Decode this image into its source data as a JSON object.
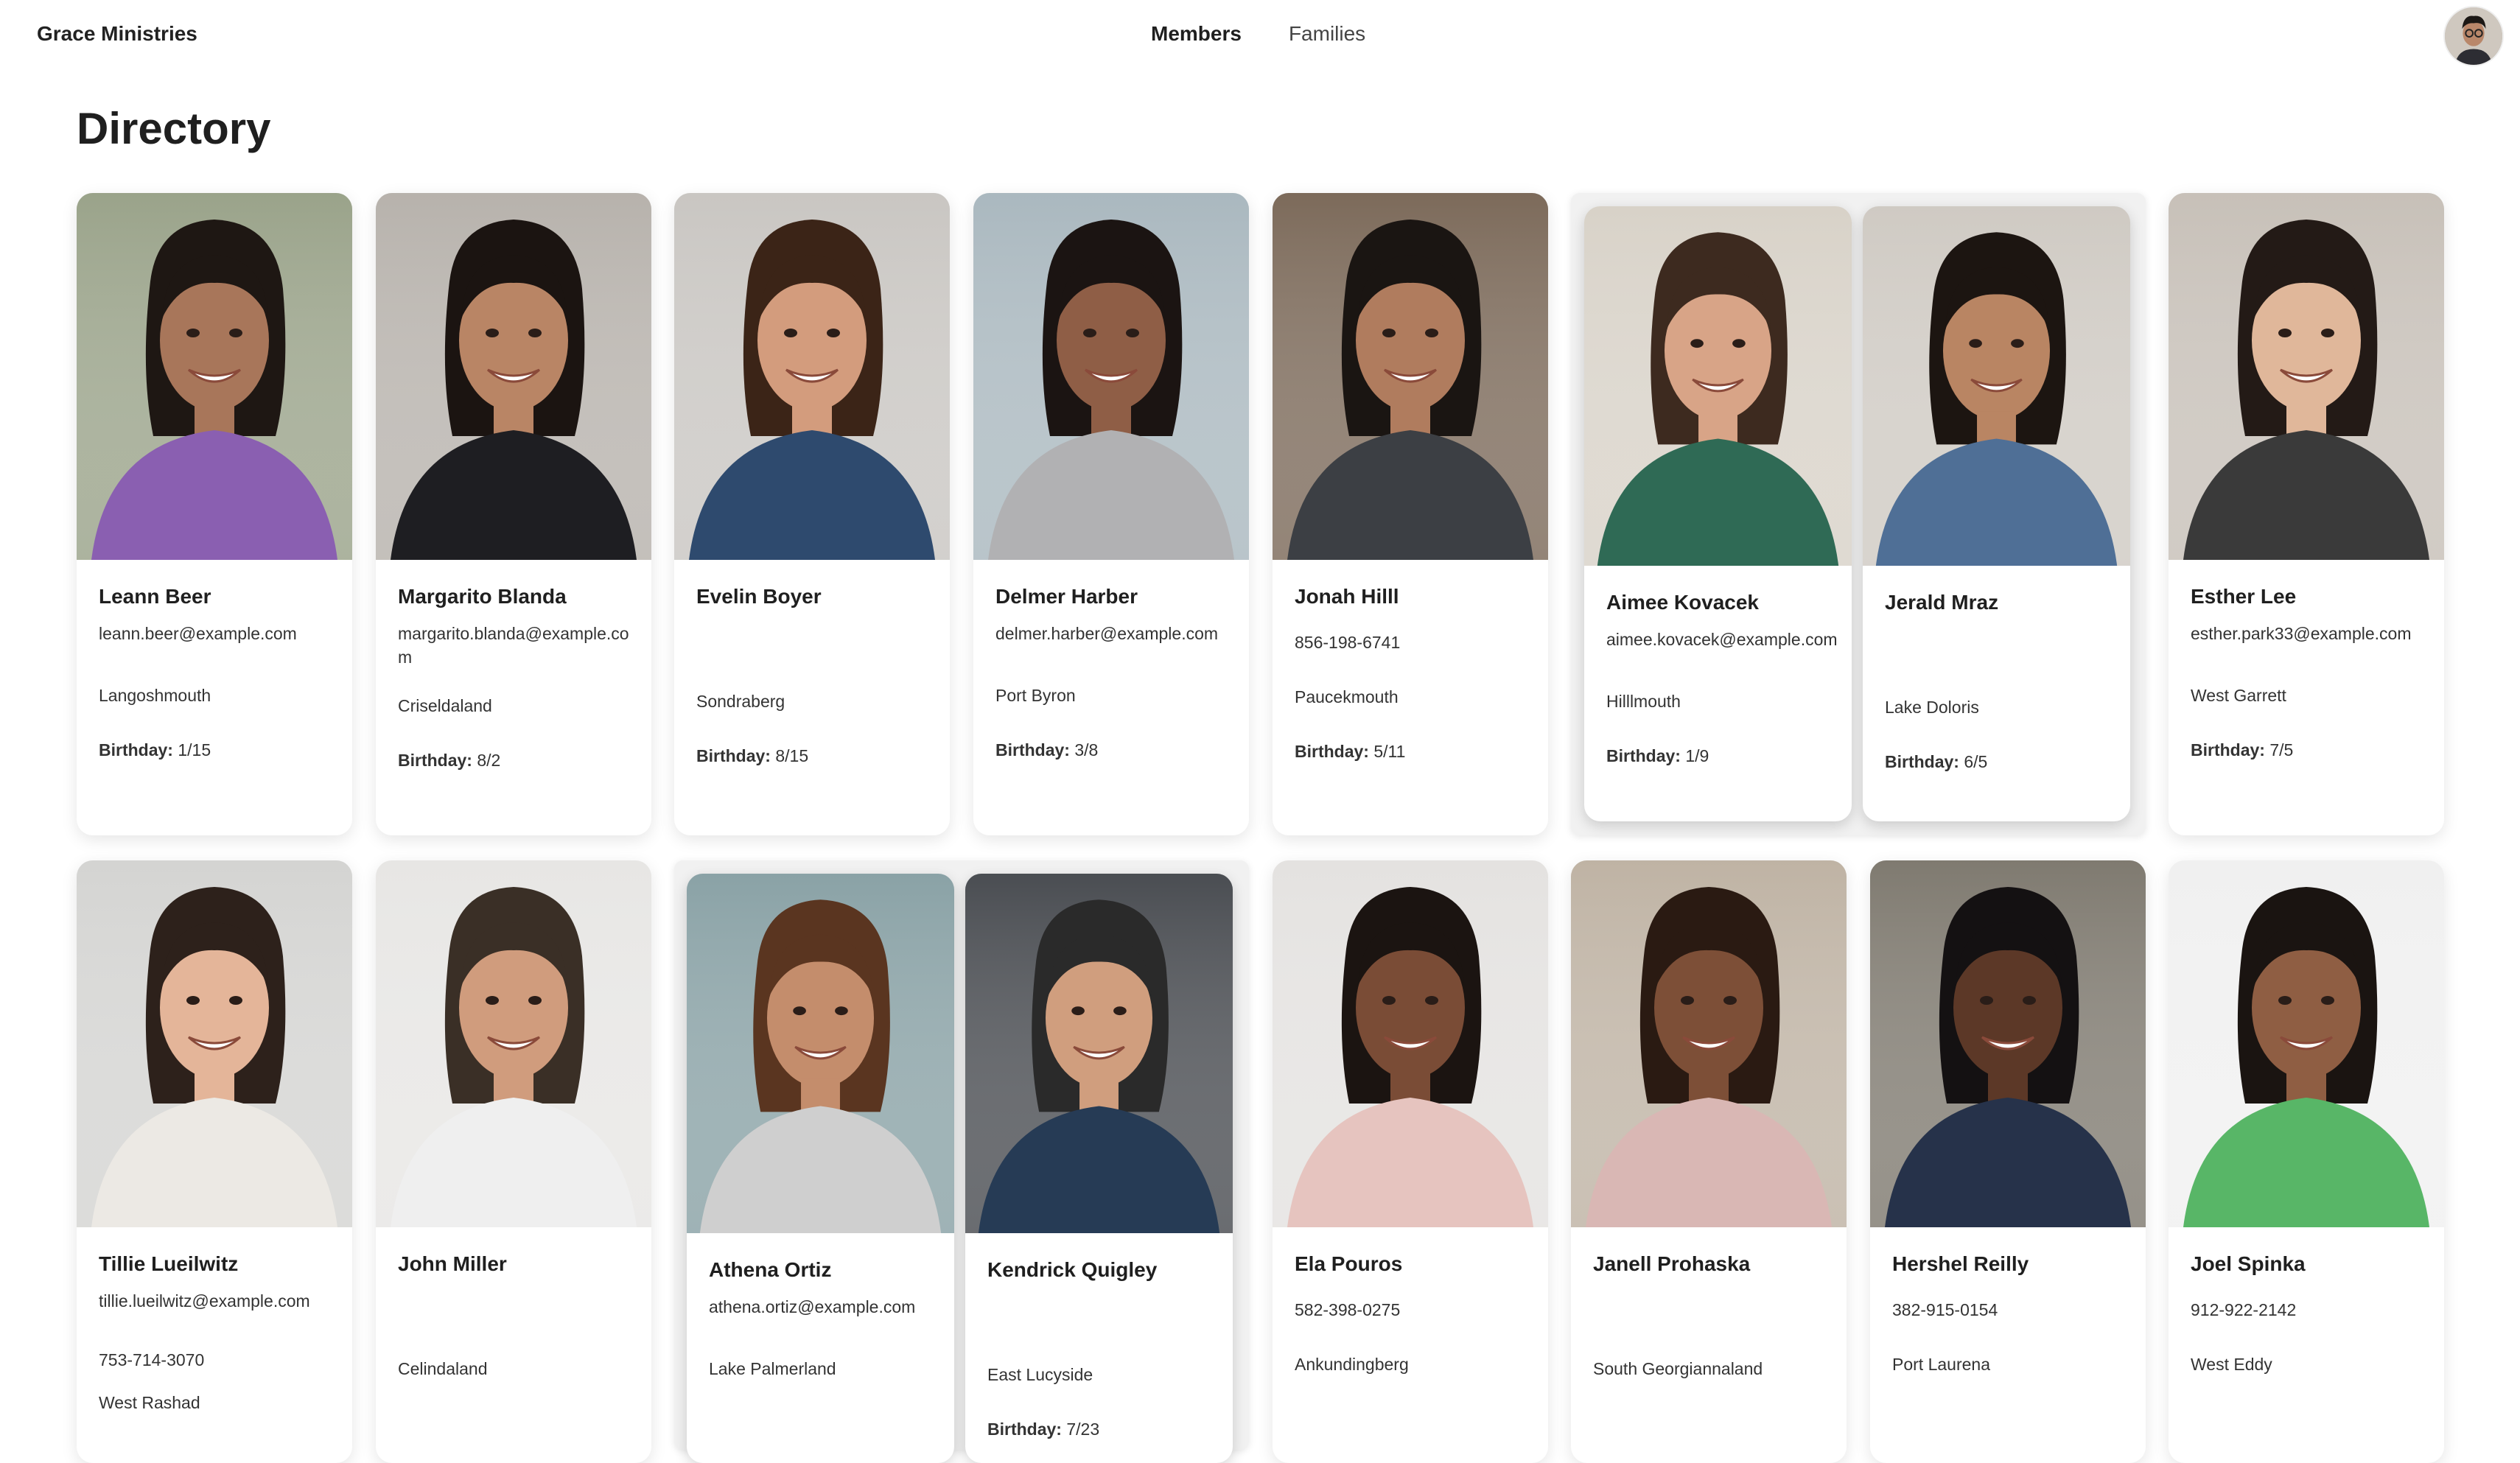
{
  "header": {
    "brand": "Grace Ministries",
    "nav": [
      {
        "label": "Members",
        "active": true
      },
      {
        "label": "Families",
        "active": false
      }
    ]
  },
  "page": {
    "title": "Directory"
  },
  "members": [
    {
      "name": "Leann Beer",
      "email": "leann.beer@example.com",
      "phone": "",
      "city": "Langoshmouth",
      "birthday_label": "Birthday:",
      "birthday": "1/15",
      "bg": "#9aa38a",
      "shirt": "#8a5fb1",
      "hair": "#1e1713",
      "skin": "#a8765a"
    },
    {
      "name": "Margarito Blanda",
      "email": "margarito.blanda@example.com",
      "phone": "",
      "city": "Criseldaland",
      "birthday_label": "Birthday:",
      "birthday": "8/2",
      "bg": "#b7b2ac",
      "shirt": "#1e1e22",
      "hair": "#1b1411",
      "skin": "#b98565"
    },
    {
      "name": "Evelin Boyer",
      "email": "",
      "phone": "",
      "city": "Sondraberg",
      "birthday_label": "Birthday:",
      "birthday": "8/15",
      "bg": "#c9c6c2",
      "shirt": "#2e4a6e",
      "hair": "#3b2417",
      "skin": "#d39c7d"
    },
    {
      "name": "Delmer Harber",
      "email": "delmer.harber@example.com",
      "phone": "",
      "city": "Port Byron",
      "birthday_label": "Birthday:",
      "birthday": "3/8",
      "bg": "#aab8bf",
      "shirt": "#b1b1b3",
      "hair": "#1b1412",
      "skin": "#8f5e46"
    },
    {
      "name": "Jonah Hilll",
      "email": "",
      "phone": "856-198-6741",
      "city": "Paucekmouth",
      "birthday_label": "Birthday:",
      "birthday": "5/11",
      "bg": "#7c6a5a",
      "shirt": "#3c3f44",
      "hair": "#1a1512",
      "skin": "#b07c5e"
    },
    {
      "name": "Aimee Kovacek",
      "email": "aimee.kovacek@example.com",
      "phone": "",
      "city": "Hilllmouth",
      "birthday_label": "Birthday:",
      "birthday": "1/9",
      "bg": "#d8d2c8",
      "shirt": "#2f6a55",
      "hair": "#3d2a1f",
      "skin": "#d8a487"
    },
    {
      "name": "Jerald Mraz",
      "email": "",
      "phone": "",
      "city": "Lake Doloris",
      "birthday_label": "Birthday:",
      "birthday": "6/5",
      "bg": "#cfcac3",
      "shirt": "#4f6f96",
      "hair": "#1c1511",
      "skin": "#b98563"
    },
    {
      "name": "Esther Lee",
      "email": "esther.park33@example.com",
      "phone": "",
      "city": "West Garrett",
      "birthday_label": "Birthday:",
      "birthday": "7/5",
      "bg": "#c7c0b8",
      "shirt": "#3a3a3a",
      "hair": "#231a16",
      "skin": "#e0b79a"
    },
    {
      "name": "Tillie Lueilwitz",
      "email": "tillie.lueilwitz@example.com",
      "phone": "753-714-3070",
      "city": "West Rashad",
      "birthday_label": "",
      "birthday": "",
      "bg": "#d4d4d2",
      "shirt": "#ece9e4",
      "hair": "#2d211b",
      "skin": "#e4b599"
    },
    {
      "name": "John Miller",
      "email": "",
      "phone": "",
      "city": "Celindaland",
      "birthday_label": "",
      "birthday": "",
      "bg": "#e7e6e4",
      "shirt": "#efefef",
      "hair": "#3a2f26",
      "skin": "#d09c7d"
    },
    {
      "name": "Athena Ortiz",
      "email": "athena.ortiz@example.com",
      "phone": "",
      "city": "Lake Palmerland",
      "birthday_label": "",
      "birthday": "",
      "bg": "#8aa2a6",
      "shirt": "#cfcfcf",
      "hair": "#5a3520",
      "skin": "#c48d6c"
    },
    {
      "name": "Kendrick Quigley",
      "email": "",
      "phone": "",
      "city": "East Lucyside",
      "birthday_label": "Birthday:",
      "birthday": "7/23",
      "bg": "#4a4d52",
      "shirt": "#263b55",
      "hair": "#2a2a2a",
      "skin": "#d09e7e"
    },
    {
      "name": "Ela Pouros",
      "email": "",
      "phone": "582-398-0275",
      "city": "Ankundingberg",
      "birthday_label": "",
      "birthday": "",
      "bg": "#e4e2e0",
      "shirt": "#e6c4bf",
      "hair": "#1b1411",
      "skin": "#7a4c36"
    },
    {
      "name": "Janell Prohaska",
      "email": "",
      "phone": "",
      "city": "South Georgiannaland",
      "birthday_label": "",
      "birthday": "",
      "bg": "#bfb3a4",
      "shirt": "#d9b7b4",
      "hair": "#2a1a12",
      "skin": "#7d4f37"
    },
    {
      "name": "Hershel Reilly",
      "email": "",
      "phone": "382-915-0154",
      "city": "Port Laurena",
      "birthday_label": "",
      "birthday": "",
      "bg": "#7f7a70",
      "shirt": "#26324a",
      "hair": "#141112",
      "skin": "#5c3827"
    },
    {
      "name": "Joel Spinka",
      "email": "",
      "phone": "912-922-2142",
      "city": "West Eddy",
      "birthday_label": "",
      "birthday": "",
      "bg": "#f0f0f0",
      "shirt": "#58b667",
      "hair": "#1a1411",
      "skin": "#8f5e43"
    }
  ]
}
